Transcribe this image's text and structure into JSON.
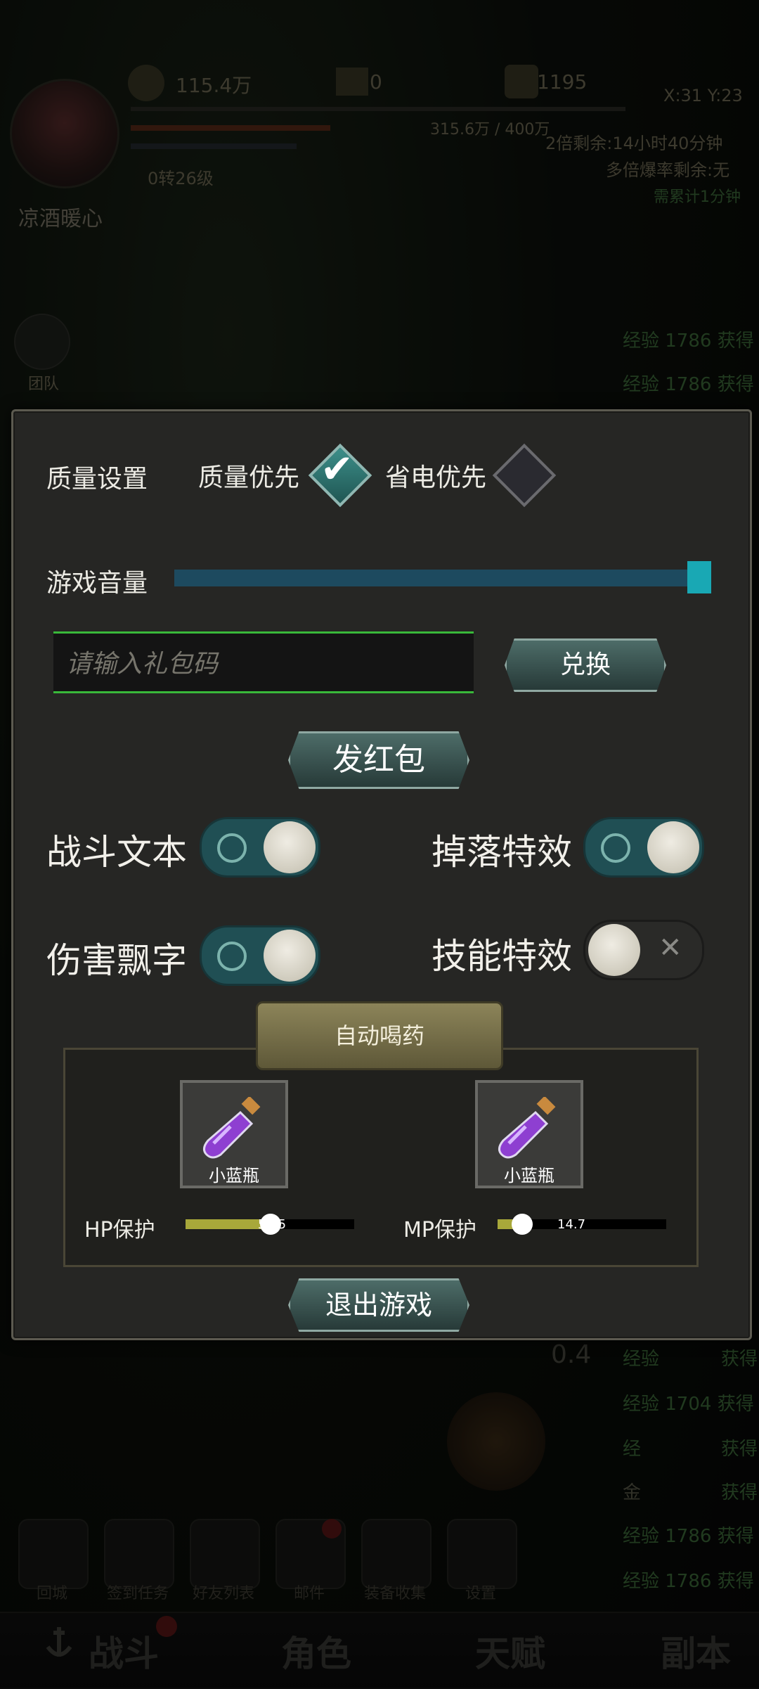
{
  "hud": {
    "gold": "115.4万",
    "diamonds": "0",
    "coins": "1195",
    "coords": "X:31 Y:23",
    "exp_progress": "315.6万 / 400万",
    "level": "0转26级",
    "player_name": "凉酒暖心",
    "double_timer": "2倍剩余:14小时40分钟",
    "multi_drop": "多倍爆率剩余:无",
    "accumulate": "需累计1分钟",
    "exp_log": [
      "经验 1786 获得",
      "经验 1786 获得",
      "经验",
      "经验 1704 获得",
      "经",
      "金",
      "经验 1786 获得",
      "经验 1786 获得"
    ],
    "log_suffix": "获得",
    "combat_value": "0.4",
    "guild_label": "团队",
    "icons": [
      "回城",
      "签到任务",
      "好友列表",
      "邮件",
      "装备收集",
      "设置"
    ]
  },
  "bottom_nav": [
    "战斗",
    "角色",
    "天赋",
    "副本"
  ],
  "settings": {
    "quality_label": "质量设置",
    "quality_option": "质量优先",
    "quality_checked": true,
    "power_option": "省电优先",
    "power_checked": false,
    "volume_label": "游戏音量",
    "volume": 1.0,
    "gift_placeholder": "请输入礼包码",
    "redeem_label": "兑换",
    "red_packet_label": "发红包",
    "toggles": {
      "battle_text": {
        "label": "战斗文本",
        "on": true
      },
      "drop_effect": {
        "label": "掉落特效",
        "on": true
      },
      "damage_float": {
        "label": "伤害飘字",
        "on": true
      },
      "skill_effect": {
        "label": "技能特效",
        "on": false
      }
    },
    "auto_potion": {
      "title": "自动喝药",
      "hp_item": "小蓝瓶",
      "mp_item": "小蓝瓶",
      "hp_label": "HP保护",
      "hp_value": "50.5",
      "hp_ratio": 0.505,
      "mp_label": "MP保护",
      "mp_value": "14.7",
      "mp_ratio": 0.147
    },
    "exit_label": "退出游戏"
  },
  "colors": {
    "accent_teal": "#19a8b4",
    "input_border": "#39b83a",
    "bar_fill": "#a8a83a"
  }
}
